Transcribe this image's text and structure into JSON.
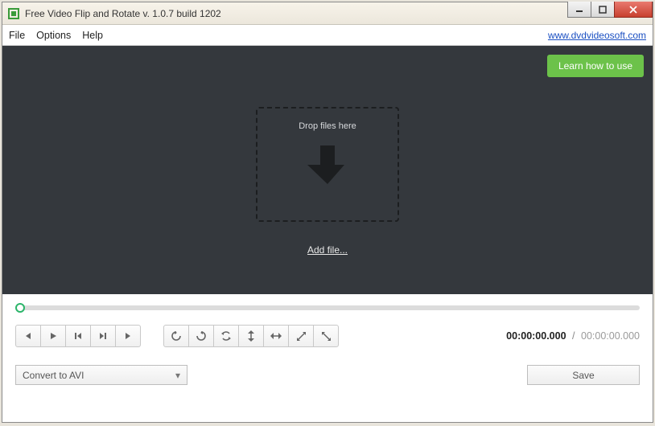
{
  "window": {
    "title": "Free Video Flip and Rotate v. 1.0.7 build 1202"
  },
  "menubar": {
    "items": [
      "File",
      "Options",
      "Help"
    ],
    "link": "www.dvdvideosoft.com"
  },
  "canvas": {
    "learn_button": "Learn how to use",
    "drop_text": "Drop files here",
    "add_file": "Add file..."
  },
  "timecode": {
    "current": "00:00:00.000",
    "total": "00:00:00.000"
  },
  "format": {
    "selected": "Convert to AVI"
  },
  "save": {
    "label": "Save"
  }
}
